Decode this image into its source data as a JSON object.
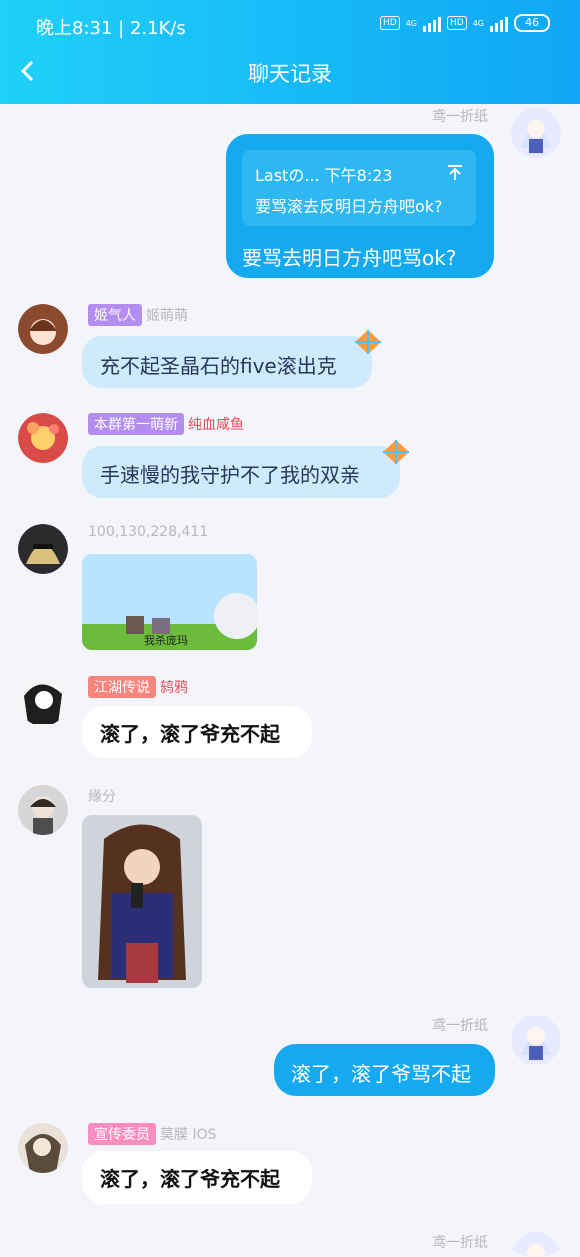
{
  "status_bar": {
    "time": "晚上8:31",
    "speed": "2.1K/s",
    "hd1": "HD",
    "hd2": "HD",
    "net1": "4G",
    "net2": "4G",
    "battery": "46"
  },
  "header": {
    "title": "聊天记录"
  },
  "messages": {
    "m1": {
      "sender": "鸢一折纸",
      "quote_header": "Lastの... 下午8:23",
      "quote_text": "要骂滚去反明日方舟吧ok?",
      "text": "要骂去明日方舟吧骂ok?"
    },
    "m2": {
      "badge": "姬气人",
      "sender": "姬萌萌",
      "text": "充不起圣晶石的five滚出克"
    },
    "m3": {
      "badge": "本群第一萌新",
      "sender": "纯血咸鱼",
      "text": "手速慢的我守护不了我的双亲"
    },
    "m4": {
      "sender": "100,130,228,411",
      "image_caption": "我杀庞玛"
    },
    "m5": {
      "badge": "江湖传说",
      "sender": "鸫鸦",
      "text": "滚了，滚了爷充不起"
    },
    "m6": {
      "sender": "缘分"
    },
    "m7": {
      "sender": "鸢一折纸",
      "text": "滚了，滚了爷骂不起"
    },
    "m8": {
      "badge": "宣传委员",
      "sender": "莫膜 IOS",
      "text": "滚了，滚了爷充不起"
    },
    "m9": {
      "sender": "鸢一折纸"
    }
  },
  "colors": {
    "header_start": "#1fd0f8",
    "header_end": "#10a6f5",
    "self_bubble": "#15a9f0",
    "vip_bubble": "#cfeafc",
    "badge_purple": "#b38df0",
    "badge_orange": "#f5857d",
    "badge_pink": "#f68fbf",
    "red_name": "#e94a57"
  },
  "icons": [
    "back-arrow-icon",
    "kite-icon",
    "quote-top-icon"
  ]
}
